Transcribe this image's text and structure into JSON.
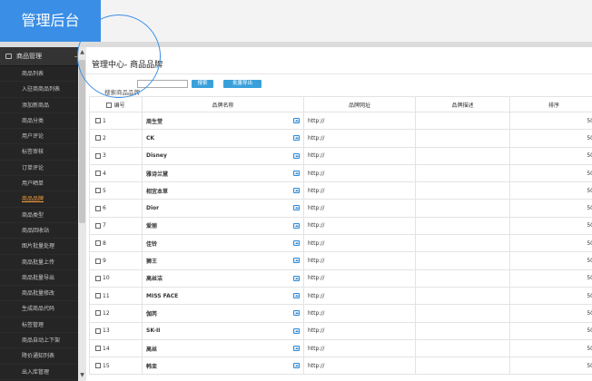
{
  "app": {
    "title": "管理后台"
  },
  "sidebar": {
    "section_label": "商品管理",
    "toggle": "−",
    "items": [
      {
        "label": "商品列表"
      },
      {
        "label": "入驻商商品列表"
      },
      {
        "label": "添加新商品"
      },
      {
        "label": "商品分类"
      },
      {
        "label": "用户评论"
      },
      {
        "label": "标签审核"
      },
      {
        "label": "订单评论"
      },
      {
        "label": "用户晒单"
      },
      {
        "label": "商品品牌",
        "active": true
      },
      {
        "label": "商品类型"
      },
      {
        "label": "商品回收站"
      },
      {
        "label": "图片批量处理"
      },
      {
        "label": "商品批量上传"
      },
      {
        "label": "商品批量导出"
      },
      {
        "label": "商品批量修改"
      },
      {
        "label": "生成商品代码"
      },
      {
        "label": "标签管理"
      },
      {
        "label": "商品自动上下架"
      },
      {
        "label": "降价通知列表"
      },
      {
        "label": "出入库管理"
      }
    ]
  },
  "page": {
    "title": "管理中心- 商品品牌"
  },
  "toolbar": {
    "search_placeholder": "",
    "search_hint": "搜索商品品牌",
    "search_button": "搜索",
    "export_button": "批量导出"
  },
  "table": {
    "columns": [
      "编号",
      "品牌名称",
      "品牌网址",
      "品牌描述",
      "排序"
    ],
    "rows": [
      {
        "id": "1",
        "name": "周生堂",
        "url": "http://",
        "desc": "",
        "sort": "50"
      },
      {
        "id": "2",
        "name": "CK",
        "url": "http://",
        "desc": "",
        "sort": "50"
      },
      {
        "id": "3",
        "name": "Disney",
        "url": "http://",
        "desc": "",
        "sort": "50"
      },
      {
        "id": "4",
        "name": "雅诗兰黛",
        "url": "http://",
        "desc": "",
        "sort": "50"
      },
      {
        "id": "5",
        "name": "相宜本草",
        "url": "http://",
        "desc": "",
        "sort": "50"
      },
      {
        "id": "6",
        "name": "Dior",
        "url": "http://",
        "desc": "",
        "sort": "50"
      },
      {
        "id": "7",
        "name": "爱丽",
        "url": "http://",
        "desc": "",
        "sort": "50"
      },
      {
        "id": "8",
        "name": "佳铃",
        "url": "http://",
        "desc": "",
        "sort": "50"
      },
      {
        "id": "9",
        "name": "狮王",
        "url": "http://",
        "desc": "",
        "sort": "50"
      },
      {
        "id": "10",
        "name": "高丝洁",
        "url": "http://",
        "desc": "",
        "sort": "50"
      },
      {
        "id": "11",
        "name": "MISS FACE",
        "url": "http://",
        "desc": "",
        "sort": "50"
      },
      {
        "id": "12",
        "name": "伽芮",
        "url": "http://",
        "desc": "",
        "sort": "50"
      },
      {
        "id": "13",
        "name": "SK-II",
        "url": "http://",
        "desc": "",
        "sort": "50"
      },
      {
        "id": "14",
        "name": "高丝",
        "url": "http://",
        "desc": "",
        "sort": "50"
      },
      {
        "id": "15",
        "name": "韩束",
        "url": "http://",
        "desc": "",
        "sort": "50"
      }
    ]
  },
  "colors": {
    "accent": "#3a8ee6",
    "sidebar_bg": "#252525",
    "active_item": "#f39a3b",
    "button": "#3aa0db"
  }
}
